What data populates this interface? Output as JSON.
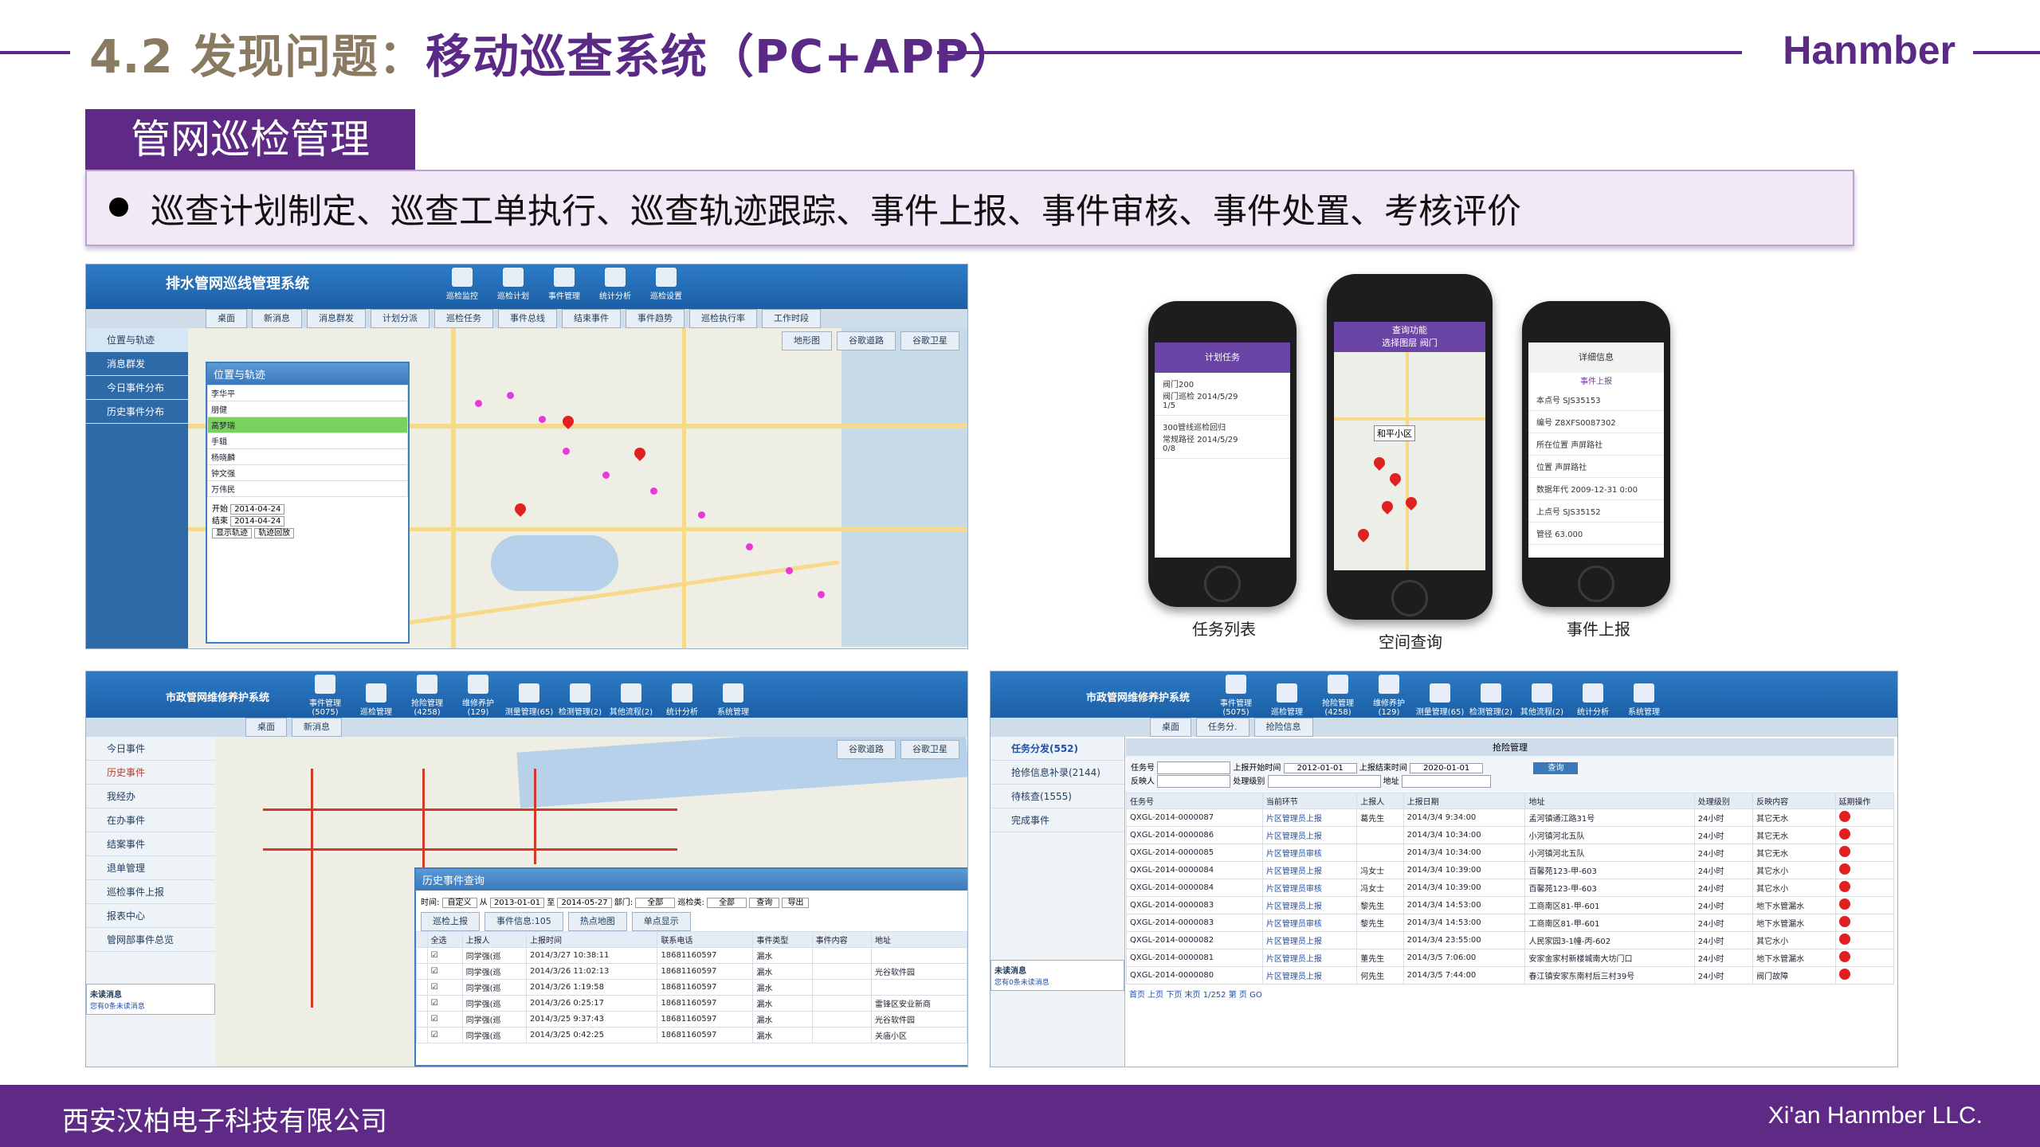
{
  "header": {
    "title_prefix": "4.2 发现问题：",
    "title_main": "移动巡查系统（PC+APP）",
    "brand": "Hanmber"
  },
  "section": {
    "tab_label": "管网巡检管理",
    "bullet": "巡查计划制定、巡查工单执行、巡查轨迹跟踪、事件上报、事件审核、事件处置、考核评价"
  },
  "screen1": {
    "app_title": "排水管网巡线管理系统",
    "tools": [
      "巡检监控",
      "巡检计划",
      "事件管理",
      "统计分析",
      "巡检设置"
    ],
    "tabs": [
      "桌面",
      "新消息",
      "消息群发",
      "计划分派",
      "巡检任务",
      "事件总线",
      "结束事件",
      "事件趋势",
      "巡检执行率",
      "工作时段"
    ],
    "sidebar": [
      "位置与轨迹",
      "消息群发",
      "今日事件分布",
      "历史事件分布"
    ],
    "map_tabs": [
      "地形图",
      "谷歌道路",
      "谷歌卫星"
    ],
    "panel_title": "位置与轨迹",
    "people": [
      "李华平",
      "朋健",
      "高梦瑞",
      "手辑",
      "杨晓麟",
      "钟文强",
      "万伟民"
    ],
    "start_label": "开始",
    "start_date": "2014-04-24",
    "end_label": "结束",
    "end_date": "2014-04-24",
    "btn_show": "显示轨迹",
    "btn_play": "轨迹回放"
  },
  "phones": {
    "p1": {
      "title": "计划任务",
      "items": [
        {
          "name": "阀门200",
          "sub": "阀门巡检",
          "date": "2014/5/29",
          "progress": "1/5"
        },
        {
          "name": "300管线巡检回归",
          "sub": "常规路径",
          "date": "2014/5/29",
          "progress": "0/8"
        }
      ],
      "caption": "任务列表"
    },
    "p2": {
      "title": "查询功能",
      "subtitle": "选择图层 阀门",
      "place": "和平小区",
      "caption": "空间查询"
    },
    "p3": {
      "title": "详细信息",
      "action": "事件上报",
      "fields": [
        [
          "本点号",
          "SJS35153"
        ],
        [
          "编号",
          "Z8XFS0087302"
        ],
        [
          "所在位置",
          "声屏路社"
        ],
        [
          "位置",
          "声屏路社"
        ],
        [
          "数据年代",
          "2009-12-31 0:00"
        ],
        [
          "上点号",
          "SJS35152"
        ],
        [
          "管径",
          "63.000"
        ]
      ],
      "caption": "事件上报"
    }
  },
  "screen2": {
    "app_title": "市政管网维修养护系统",
    "tools": [
      "事件管理(5075)",
      "巡检管理",
      "抢险管理(4258)",
      "维修养护(129)",
      "测量管理(65)",
      "检测管理(2)",
      "其他流程(2)",
      "统计分析",
      "系统管理"
    ],
    "tabs": [
      "桌面",
      "新消息"
    ],
    "sidebar": [
      "今日事件",
      "历史事件",
      "我经办",
      "在办事件",
      "结案事件",
      "退单管理",
      "巡检事件上报",
      "报表中心",
      "管网部事件总览"
    ],
    "map_tabs": [
      "谷歌道路",
      "谷歌卫星"
    ],
    "panel_title": "历史事件查询",
    "filter": {
      "time": "时间:",
      "range": "自定义",
      "from_label": "从",
      "from": "2013-01-01",
      "to_label": "至",
      "to": "2014-05-27",
      "dept": "部门:",
      "dept_val": "全部",
      "type": "巡检类:",
      "type_val": "全部",
      "query": "查询",
      "export": "导出"
    },
    "sub_tabs": [
      "巡检上报",
      "事件信息:105",
      "热点地图",
      "单点显示"
    ],
    "columns": [
      "",
      "全选",
      "上报人",
      "上报时间",
      "联系电话",
      "事件类型",
      "事件内容",
      "地址"
    ],
    "rows": [
      [
        "",
        "",
        "同学强(巡",
        "2014/3/27 10:38:11",
        "18681160597",
        "漏水",
        "",
        ""
      ],
      [
        "",
        "",
        "同学强(巡",
        "2014/3/26 11:02:13",
        "18681160597",
        "漏水",
        "",
        "光谷软件园"
      ],
      [
        "",
        "",
        "同学强(巡",
        "2014/3/26 1:19:58",
        "18681160597",
        "漏水",
        "",
        ""
      ],
      [
        "",
        "",
        "同学强(巡",
        "2014/3/26 0:25:17",
        "18681160597",
        "漏水",
        "",
        "雷锋区安业新商"
      ],
      [
        "",
        "",
        "同学强(巡",
        "2014/3/25 9:37:43",
        "18681160597",
        "漏水",
        "",
        "光谷软件园"
      ],
      [
        "",
        "",
        "同学强(巡",
        "2014/3/25 0:42:25",
        "18681160597",
        "漏水",
        "",
        "关庙小区"
      ]
    ],
    "unread_title": "未读消息",
    "unread_text": "您有0条未读消息"
  },
  "screen3": {
    "app_title": "市政管网维修养护系统",
    "tools": [
      "事件管理(5075)",
      "巡检管理",
      "抢险管理(4258)",
      "维修养护(129)",
      "测量管理(65)",
      "检测管理(2)",
      "其他流程(2)",
      "统计分析",
      "系统管理"
    ],
    "tabs": [
      "桌面",
      "任务分.",
      "抢险信息"
    ],
    "sidebar": [
      "任务分发(552)",
      "抢修信息补录(2144)",
      "待核查(1555)",
      "完成事件"
    ],
    "filter": {
      "task": "任务号",
      "start": "上报开始时间",
      "start_val": "2012-01-01",
      "end": "上报结束时间",
      "end_val": "2020-01-01",
      "reporter": "反映人",
      "level": "处理级别",
      "addr": "地址",
      "query": "查询",
      "title": "抢险管理"
    },
    "columns": [
      "任务号",
      "当前环节",
      "上报人",
      "上报日期",
      "地址",
      "处理级别",
      "反映内容",
      "延期操作"
    ],
    "rows": [
      [
        "QXGL-2014-0000087",
        "片区管理员上报",
        "葛先生",
        "2014/3/4 9:34:00",
        "孟河镇通江路31号",
        "24小时",
        "其它无水"
      ],
      [
        "QXGL-2014-0000086",
        "片区管理员上报",
        "",
        "2014/3/4 10:34:00",
        "小河镇河北五队",
        "24小时",
        "其它无水"
      ],
      [
        "QXGL-2014-0000085",
        "片区管理员审核",
        "",
        "2014/3/4 10:34:00",
        "小河镇河北五队",
        "24小时",
        "其它无水"
      ],
      [
        "QXGL-2014-0000084",
        "片区管理员上报",
        "冯女士",
        "2014/3/4 10:39:00",
        "百馨苑123-甲-603",
        "24小时",
        "其它水小"
      ],
      [
        "QXGL-2014-0000084",
        "片区管理员审核",
        "冯女士",
        "2014/3/4 10:39:00",
        "百馨苑123-甲-603",
        "24小时",
        "其它水小"
      ],
      [
        "QXGL-2014-0000083",
        "片区管理员上报",
        "黎先生",
        "2014/3/4 14:53:00",
        "工商南区81-甲-601",
        "24小时",
        "地下水管漏水"
      ],
      [
        "QXGL-2014-0000083",
        "片区管理员审核",
        "黎先生",
        "2014/3/4 14:53:00",
        "工商南区81-甲-601",
        "24小时",
        "地下水管漏水"
      ],
      [
        "QXGL-2014-0000082",
        "片区管理员上报",
        "",
        "2014/3/4 23:55:00",
        "人民家园3-1幢-丙-602",
        "24小时",
        "其它水小"
      ],
      [
        "QXGL-2014-0000081",
        "片区管理员上报",
        "董先生",
        "2014/3/5 7:06:00",
        "安家金家村新楼城南大坊门口",
        "24小时",
        "地下水管漏水"
      ],
      [
        "QXGL-2014-0000080",
        "片区管理员上报",
        "何先生",
        "2014/3/5 7:44:00",
        "春江镇安家东南村后三村39号",
        "24小时",
        "阀门故障"
      ]
    ],
    "pager": "首页 上页 下页 末页 1/252 第 页 GO",
    "unread_title": "未读消息",
    "unread_text": "您有0条未读消息"
  },
  "footer": {
    "company_cn": "西安汉柏电子科技有限公司",
    "company_en": "Xi'an Hanmber LLC."
  }
}
